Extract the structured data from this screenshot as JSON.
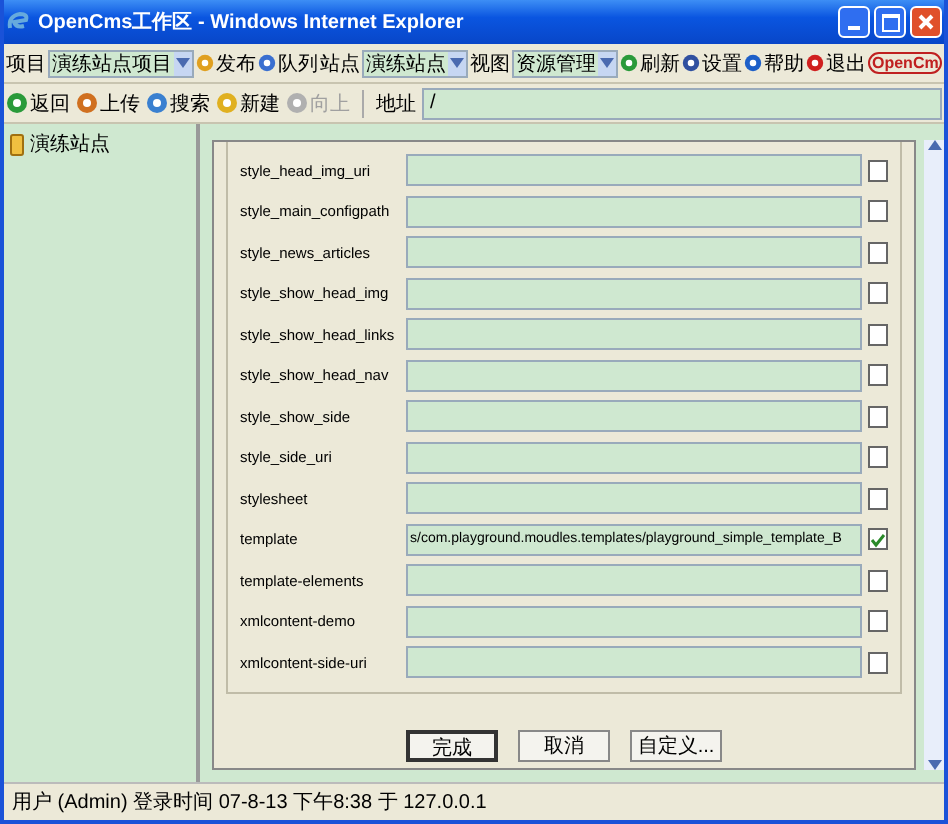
{
  "window": {
    "title": "OpenCms工作区 - Windows Internet Explorer"
  },
  "toolbar": [
    {
      "kind": "label",
      "text": "项目"
    },
    {
      "kind": "select",
      "value": "演练站点项目"
    },
    {
      "kind": "button",
      "text": "发布"
    },
    {
      "kind": "button",
      "text": "队列"
    },
    {
      "kind": "label",
      "text": "站点"
    },
    {
      "kind": "select",
      "value": "演练站点"
    },
    {
      "kind": "label",
      "text": "视图"
    },
    {
      "kind": "select",
      "value": "资源管理"
    },
    {
      "kind": "button",
      "text": "刷新"
    },
    {
      "kind": "button",
      "text": "设置"
    },
    {
      "kind": "button",
      "text": "帮助"
    },
    {
      "kind": "button",
      "text": "退出"
    },
    {
      "kind": "logo",
      "text": "OpenCm"
    }
  ],
  "nav": [
    {
      "text": "返回",
      "disabled": false
    },
    {
      "text": "上传",
      "disabled": false
    },
    {
      "text": "搜索",
      "disabled": false
    },
    {
      "text": "新建",
      "disabled": false
    },
    {
      "text": "向上",
      "disabled": true
    }
  ],
  "address": {
    "label": "地址",
    "value": "/"
  },
  "tree": [
    {
      "text": "演练站点"
    }
  ],
  "rows": [
    {
      "label": "style_head_img_uri",
      "checked": false
    },
    {
      "label": "style_main_configpath",
      "checked": false
    },
    {
      "label": "style_news_articles",
      "checked": false
    },
    {
      "label": "style_show_head_img",
      "checked": false
    },
    {
      "label": "style_show_head_links",
      "checked": false
    },
    {
      "label": "style_show_head_nav",
      "checked": false
    },
    {
      "label": "style_show_side",
      "checked": false
    },
    {
      "label": "style_side_uri",
      "checked": false
    },
    {
      "label": "stylesheet",
      "checked": false
    },
    {
      "label": "template",
      "value": "s/com.playground.moudles.templates/playground_simple_template_B",
      "checked": true
    },
    {
      "label": "template-elements",
      "checked": false
    },
    {
      "label": "xmlcontent-demo",
      "checked": false
    },
    {
      "label": "xmlcontent-side-uri",
      "checked": false
    }
  ],
  "buttons": [
    {
      "text": "完成",
      "default": true
    },
    {
      "text": "取消",
      "default": false
    },
    {
      "text": "自定义...",
      "default": false
    }
  ],
  "status_bar": "用户 (Admin) 登录时间 07-8-13 下午8:38 于 127.0.0.1"
}
